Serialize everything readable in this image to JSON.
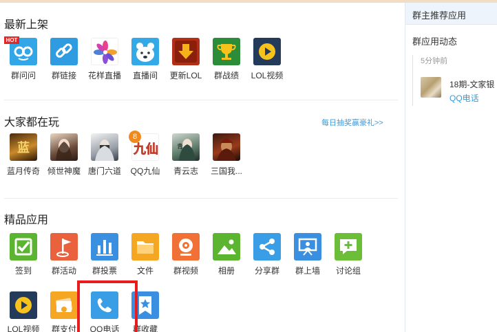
{
  "sections": {
    "new": {
      "title": "最新上架",
      "hot_badge": "HOT"
    },
    "popular": {
      "title": "大家都在玩",
      "more_link": "每日抽奖赢豪礼>>",
      "badge_count": "8"
    },
    "premium": {
      "title": "精品应用"
    }
  },
  "new_apps": [
    {
      "label": "群问问",
      "icon": "owl-glasses-icon",
      "color": "#32a6e6"
    },
    {
      "label": "群链接",
      "icon": "chain-link-icon",
      "color": "#2f9be0"
    },
    {
      "label": "花样直播",
      "icon": "flower-icon",
      "color": "#ffffff"
    },
    {
      "label": "直播间",
      "icon": "polar-bear-icon",
      "color": "#34a9e8"
    },
    {
      "label": "更新LOL",
      "icon": "download-arrow-icon",
      "color": "#b32e16"
    },
    {
      "label": "群战绩",
      "icon": "trophy-icon",
      "color": "#2b8c3a"
    },
    {
      "label": "LOL视频",
      "icon": "play-button-icon",
      "color": "#243a5a"
    }
  ],
  "games": [
    {
      "label": "蓝月传奇",
      "icon": "game-lanyue-icon"
    },
    {
      "label": "倾世神魔",
      "icon": "game-qingshi-icon"
    },
    {
      "label": "唐门六道",
      "icon": "game-tangmen-icon"
    },
    {
      "label": "QQ九仙",
      "icon": "game-jiuxian-icon"
    },
    {
      "label": "青云志",
      "icon": "game-qingyun-icon"
    },
    {
      "label": "三国我...",
      "icon": "game-sanguo-icon"
    }
  ],
  "premium_apps": [
    {
      "label": "签到",
      "icon": "checkmark-icon",
      "color": "#5cb531"
    },
    {
      "label": "群活动",
      "icon": "flag-icon",
      "color": "#e9623d"
    },
    {
      "label": "群投票",
      "icon": "bar-chart-icon",
      "color": "#3a8fe0"
    },
    {
      "label": "文件",
      "icon": "folder-icon",
      "color": "#f5a623"
    },
    {
      "label": "群视频",
      "icon": "webcam-icon",
      "color": "#f07035"
    },
    {
      "label": "相册",
      "icon": "mountain-photo-icon",
      "color": "#5cb531"
    },
    {
      "label": "分享群",
      "icon": "share-icon",
      "color": "#3a9ee6"
    },
    {
      "label": "群上墙",
      "icon": "presentation-icon",
      "color": "#3a8fe0"
    },
    {
      "label": "讨论组",
      "icon": "chat-plus-icon",
      "color": "#6cbd38"
    },
    {
      "label": "LOL视频",
      "icon": "play-button-icon",
      "color": "#243a5a"
    },
    {
      "label": "群支付",
      "icon": "wallet-icon",
      "color": "#f5a623"
    },
    {
      "label": "QQ电话",
      "icon": "phone-icon",
      "color": "#3a9ee6"
    },
    {
      "label": "群收藏",
      "icon": "star-bookmark-icon",
      "color": "#3a8fe0"
    }
  ],
  "sidebar": {
    "header": "群主推荐应用",
    "subtitle": "群应用动态",
    "feed": {
      "time_ago": "5分钟前",
      "title": "18期-文家银",
      "link": "QQ电话"
    }
  },
  "colors": {
    "accent": "#3a9bd9",
    "highlight": "#e81c1c"
  }
}
